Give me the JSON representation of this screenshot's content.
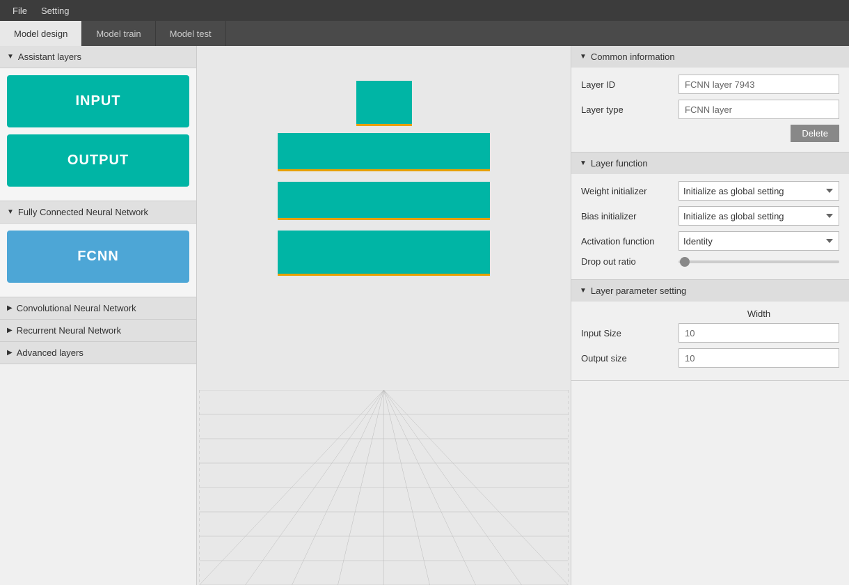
{
  "menubar": {
    "items": [
      "File",
      "Setting"
    ]
  },
  "tabs": [
    {
      "label": "Model design",
      "active": true
    },
    {
      "label": "Model train",
      "active": false
    },
    {
      "label": "Model test",
      "active": false
    }
  ],
  "sidebar": {
    "assistant_layers": {
      "header": "Assistant layers",
      "expanded": true,
      "items": [
        {
          "label": "INPUT",
          "type": "input"
        },
        {
          "label": "OUTPUT",
          "type": "output"
        }
      ]
    },
    "fcnn": {
      "header": "Fully Connected Neural Network",
      "expanded": true,
      "items": [
        {
          "label": "FCNN",
          "type": "fcnn"
        }
      ]
    },
    "cnn": {
      "header": "Convolutional Neural Network",
      "expanded": false
    },
    "rnn": {
      "header": "Recurrent Neural Network",
      "expanded": false
    },
    "advanced": {
      "header": "Advanced layers",
      "expanded": false
    }
  },
  "right_panel": {
    "common_info": {
      "header": "Common information",
      "layer_id_label": "Layer ID",
      "layer_id_value": "FCNN layer 7943",
      "layer_type_label": "Layer type",
      "layer_type_value": "FCNN layer",
      "delete_label": "Delete"
    },
    "layer_function": {
      "header": "Layer function",
      "weight_label": "Weight initializer",
      "weight_value": "Initialize as global setting",
      "bias_label": "Bias initializer",
      "bias_value": "Initialize as global setting",
      "activation_label": "Activation function",
      "activation_value": "Identity",
      "dropout_label": "Drop out ratio"
    },
    "layer_param": {
      "header": "Layer parameter setting",
      "width_label": "Width",
      "input_size_label": "Input Size",
      "input_size_value": "10",
      "output_size_label": "Output size",
      "output_size_value": "10"
    }
  }
}
